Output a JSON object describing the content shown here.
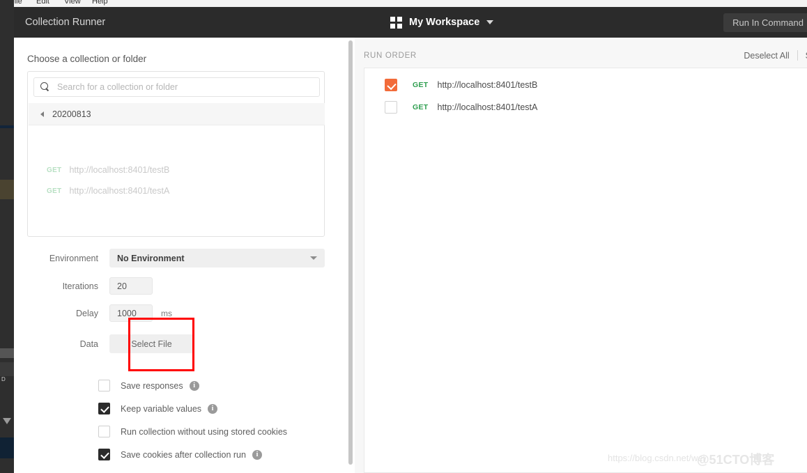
{
  "window": {
    "app_title": "Collection Runner",
    "menu_items": [
      "File",
      "Edit",
      "View",
      "Help"
    ]
  },
  "header": {
    "workspace_icon": "grid-icon",
    "workspace_name": "My Workspace",
    "workspace_caret": "chevron-down-icon",
    "run_in_command_label": "Run In Command"
  },
  "left_panel": {
    "title": "Choose a collection or folder",
    "search": {
      "icon": "search-icon",
      "placeholder": "Search for a collection or folder",
      "value": ""
    },
    "collection": {
      "name": "20200813",
      "expander_icon": "triangle-left-icon"
    },
    "requests": [
      {
        "method": "GET",
        "url": "http://localhost:8401/testB"
      },
      {
        "method": "GET",
        "url": "http://localhost:8401/testA"
      }
    ],
    "form": {
      "environment_label": "Environment",
      "environment_value": "No Environment",
      "environment_caret": "chevron-down-icon",
      "iterations_label": "Iterations",
      "iterations_value": "20",
      "delay_label": "Delay",
      "delay_value": "1000",
      "delay_unit": "ms",
      "data_label": "Data",
      "select_file_label": "Select File"
    },
    "options": [
      {
        "label": "Save responses",
        "checked": false,
        "info": true
      },
      {
        "label": "Keep variable values",
        "checked": true,
        "info": true
      },
      {
        "label": "Run collection without using stored cookies",
        "checked": false,
        "info": false
      },
      {
        "label": "Save cookies after collection run",
        "checked": true,
        "info": true
      }
    ]
  },
  "right_panel": {
    "run_order_label": "RUN ORDER",
    "deselect_all_label": "Deselect All",
    "select_all_label": "S",
    "items": [
      {
        "method": "GET",
        "url": "http://localhost:8401/testB",
        "checked": true
      },
      {
        "method": "GET",
        "url": "http://localhost:8401/testA",
        "checked": false
      }
    ]
  },
  "annotations": {
    "highlight_color": "#ff0000",
    "highlight_target": "iterations-and-delay-inputs"
  },
  "watermarks": {
    "url": "https://blog.csdn.net/wei",
    "brand": "@51CTO博客"
  },
  "colors": {
    "titlebar": "#2b2b2b",
    "accent_orange": "#f26b3a",
    "method_green": "#2e9e4f",
    "panel_bg": "#f7f7f7"
  }
}
